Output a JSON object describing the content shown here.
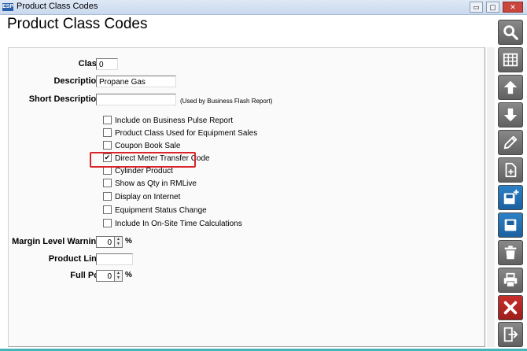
{
  "window": {
    "icon_text": "ESP",
    "title": "Product Class Codes",
    "controls": {
      "minimize": "▭",
      "restore": "▢",
      "close": "✕"
    }
  },
  "page_title": "Product Class Codes",
  "form": {
    "class": {
      "label": "Class",
      "value": "0"
    },
    "description": {
      "label": "Description",
      "value": "Propane Gas"
    },
    "short_description": {
      "label": "Short Description",
      "value": "",
      "note": "(Used by Business Flash Report)"
    },
    "checkboxes": [
      {
        "label": "Include on Business Pulse Report",
        "checked": false
      },
      {
        "label": "Product Class Used for Equipment Sales",
        "checked": false
      },
      {
        "label": "Coupon Book Sale",
        "checked": false
      },
      {
        "label": "Direct Meter Transfer Code",
        "checked": true,
        "highlighted": true
      },
      {
        "label": "Cylinder Product",
        "checked": false
      },
      {
        "label": "Show as Qty in RMLive",
        "checked": false
      },
      {
        "label": "Display on Internet",
        "checked": false
      },
      {
        "label": "Equipment Status Change",
        "checked": false
      },
      {
        "label": "Include In On-Site Time Calculations",
        "checked": false
      }
    ],
    "margin_level_warning": {
      "label": "Margin Level Warning",
      "value": "0",
      "unit": "%"
    },
    "product_line": {
      "label": "Product Line",
      "value": ""
    },
    "full_pct": {
      "label": "Full Pct",
      "value": "0",
      "unit": "%"
    },
    "checkmark_glyph": "✔"
  },
  "toolbar": [
    {
      "name": "search-icon",
      "style": "gray"
    },
    {
      "name": "grid-icon",
      "style": "gray"
    },
    {
      "name": "arrow-up-icon",
      "style": "gray"
    },
    {
      "name": "arrow-down-icon",
      "style": "gray"
    },
    {
      "name": "pencil-icon",
      "style": "gray"
    },
    {
      "name": "new-document-icon",
      "style": "gray"
    },
    {
      "name": "save-new-icon",
      "style": "blue"
    },
    {
      "name": "save-icon",
      "style": "blue"
    },
    {
      "name": "trash-icon",
      "style": "gray"
    },
    {
      "name": "print-icon",
      "style": "gray"
    },
    {
      "name": "close-icon",
      "style": "red"
    },
    {
      "name": "exit-icon",
      "style": "gray"
    }
  ],
  "colors": {
    "highlight": "#d9252a",
    "save_blue": "#1b5f9f",
    "close_red": "#b52a26",
    "toolbar_gray": "#6f6f6f"
  }
}
